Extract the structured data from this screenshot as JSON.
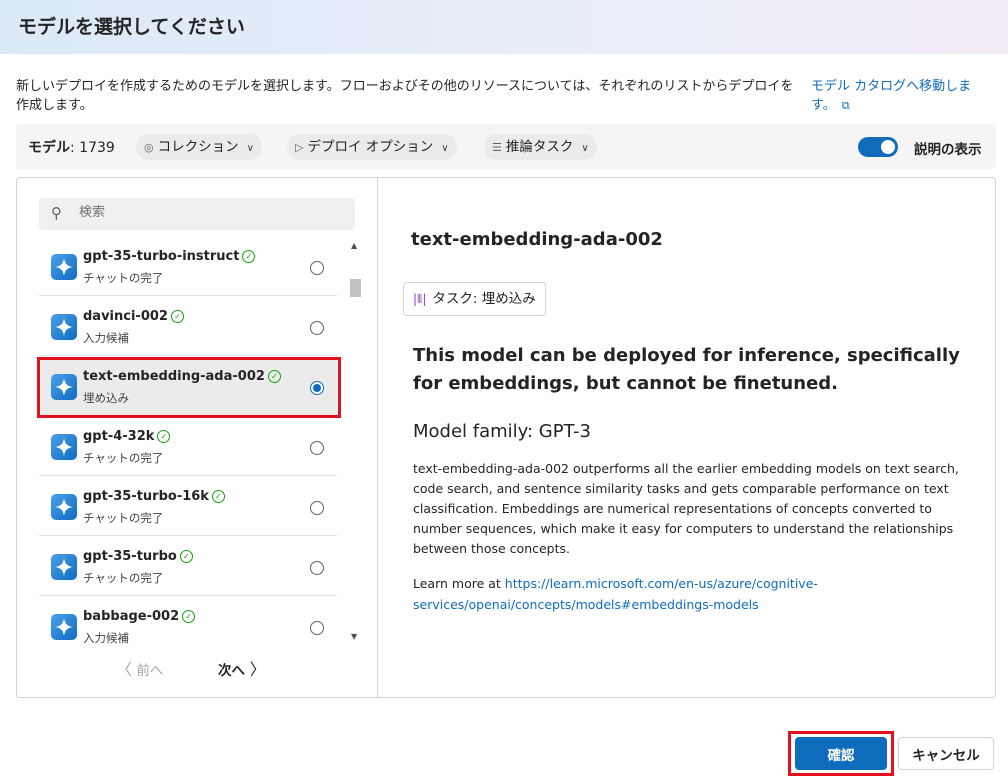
{
  "header": {
    "title": "モデルを選択してください"
  },
  "intro": {
    "text": "新しいデプロイを作成するためのモデルを選択します。フローおよびその他のリソースについては、それぞれのリストからデプロイを作成します。",
    "catalog_link": "モデル カタログへ移動します。"
  },
  "toolbar": {
    "model_label": "モデル",
    "model_count": ": 1739",
    "filters": [
      {
        "label": "コレクション",
        "icon": "collection-icon"
      },
      {
        "label": "デプロイ オプション",
        "icon": "play-icon"
      },
      {
        "label": "推論タスク",
        "icon": "list-icon"
      }
    ],
    "toggle_on": true,
    "toggle_label": "説明の表示"
  },
  "search": {
    "placeholder": "検索",
    "value": ""
  },
  "models": [
    {
      "name": "gpt-35-turbo-instruct",
      "task": "チャットの完了",
      "selected": false
    },
    {
      "name": "davinci-002",
      "task": "入力候補",
      "selected": false
    },
    {
      "name": "text-embedding-ada-002",
      "task": "埋め込み",
      "selected": true
    },
    {
      "name": "gpt-4-32k",
      "task": "チャットの完了",
      "selected": false
    },
    {
      "name": "gpt-35-turbo-16k",
      "task": "チャットの完了",
      "selected": false
    },
    {
      "name": "gpt-35-turbo",
      "task": "チャットの完了",
      "selected": false
    },
    {
      "name": "babbage-002",
      "task": "入力候補",
      "selected": false
    }
  ],
  "pager": {
    "prev": "前へ",
    "next": "次へ"
  },
  "detail": {
    "title": "text-embedding-ada-002",
    "task_tag": "タスク: 埋め込み",
    "summary": "This model can be deployed for inference, specifically for embeddings, but cannot be finetuned.",
    "family": "Model family: GPT-3",
    "description": "text-embedding-ada-002 outperforms all the earlier embedding models on text search, code search, and sentence similarity tasks and gets comparable performance on text classification. Embeddings are numerical representations of concepts converted to number sequences, which make it easy for computers to understand the relationships between those concepts.",
    "learn_more": "Learn more at ",
    "learn_link": "https://learn.microsoft.com/en-us/azure/cognitive-services/openai/concepts/models#embeddings-models"
  },
  "footer": {
    "confirm": "確認",
    "cancel": "キャンセル"
  },
  "colors": {
    "accent": "#0f6cbd",
    "highlight": "#e3101e",
    "verified": "#13a10e"
  }
}
